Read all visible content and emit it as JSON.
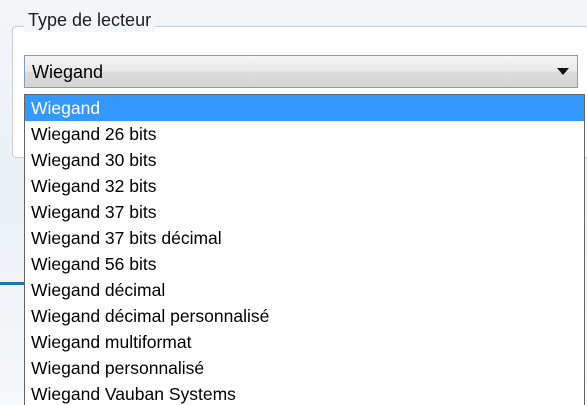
{
  "group": {
    "label": "Type de lecteur"
  },
  "combo": {
    "value": "Wiegand"
  },
  "dropdown": {
    "items": [
      "Wiegand",
      "Wiegand 26 bits",
      "Wiegand 30 bits",
      "Wiegand 32 bits",
      "Wiegand 37 bits",
      "Wiegand 37 bits décimal",
      "Wiegand 56 bits",
      "Wiegand décimal",
      "Wiegand décimal personnalisé",
      "Wiegand multiformat",
      "Wiegand personnalisé",
      "Wiegand Vauban Systems"
    ],
    "selected_index": 0
  },
  "icons": {
    "combo_arrow": "chevron-down-icon"
  },
  "colors": {
    "selection": "#3399ff",
    "selection_text": "#ffffff"
  }
}
